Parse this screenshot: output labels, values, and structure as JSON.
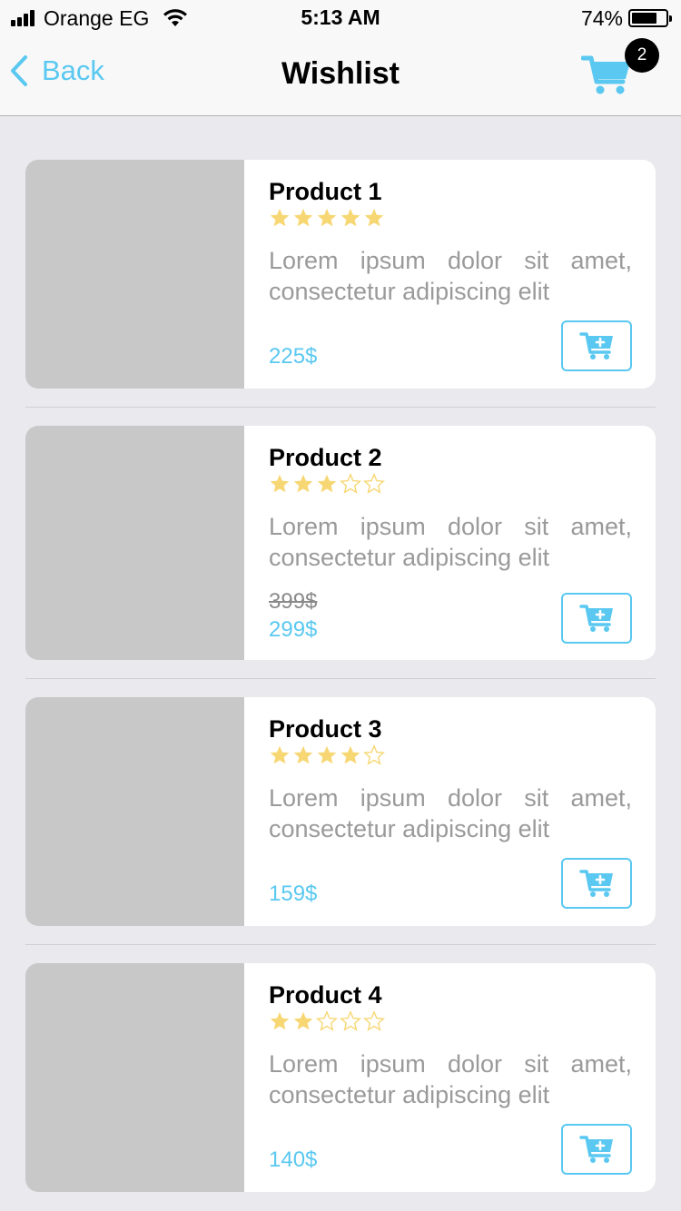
{
  "status_bar": {
    "carrier": "Orange EG",
    "time": "5:13 AM",
    "battery": "74%"
  },
  "nav": {
    "back_label": "Back",
    "title": "Wishlist",
    "cart_count": "2"
  },
  "colors": {
    "accent": "#5ac8f0",
    "star": "#f7d774",
    "star_empty": "#f7d774",
    "thumb": "#c8c8c8"
  },
  "products": [
    {
      "name": "Product 1",
      "rating": 5,
      "description": "Lorem ipsum dolor sit amet, consectetur adipiscing elit",
      "old_price": "",
      "price": "225$"
    },
    {
      "name": "Product 2",
      "rating": 3,
      "description": "Lorem ipsum dolor sit amet, consectetur adipiscing elit",
      "old_price": "399$",
      "price": "299$"
    },
    {
      "name": "Product 3",
      "rating": 4,
      "description": "Lorem ipsum dolor sit amet, consectetur adipiscing elit",
      "old_price": "",
      "price": "159$"
    },
    {
      "name": "Product 4",
      "rating": 2,
      "description": "Lorem ipsum dolor sit amet, consectetur adipiscing elit",
      "old_price": "",
      "price": "140$"
    }
  ]
}
